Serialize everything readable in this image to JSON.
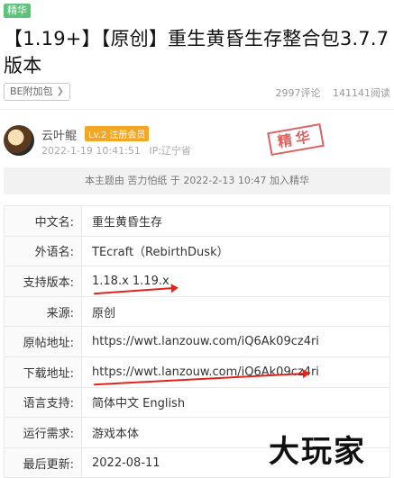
{
  "post": {
    "badge": "精华",
    "title": "【1.19+】【原创】重生黄昏生存整合包3.7.7版本",
    "plugin_label": "BE附加包",
    "comments": "2997评论",
    "reads": "141141阅读"
  },
  "author": {
    "name": "云叶鲲",
    "level": "Lv.2 注册会员",
    "date": "2022-1-19 10:41:51",
    "ip": "IP:辽宁省"
  },
  "stamp": "精华",
  "essence_note": "本主题由 苦力怕纸 于 2022-2-13 10:47 加入精华",
  "info": [
    {
      "key": "中文名:",
      "value": "重生黄昏生存"
    },
    {
      "key": "外语名:",
      "value": "TEcraft（RebirthDusk）"
    },
    {
      "key": "支持版本:",
      "value": "1.18.x 1.19.x"
    },
    {
      "key": "来源:",
      "value": "原创"
    },
    {
      "key": "原帖地址:",
      "value": "https://wwt.lanzouw.com/iQ6Ak09cz4ri"
    },
    {
      "key": "下载地址:",
      "value": "https://wwt.lanzouw.com/iQ6Ak09cz4ri"
    },
    {
      "key": "语言支持:",
      "value": "简体中文 English"
    },
    {
      "key": "运行需求:",
      "value": "游戏本体"
    },
    {
      "key": "最后更新:",
      "value": "2022-08-11"
    }
  ],
  "watermark": "大玩家",
  "colors": {
    "badge": "#5ec27a",
    "level": "#f5a623",
    "stamp": "#d9534f",
    "arrow": "#e0241b"
  }
}
